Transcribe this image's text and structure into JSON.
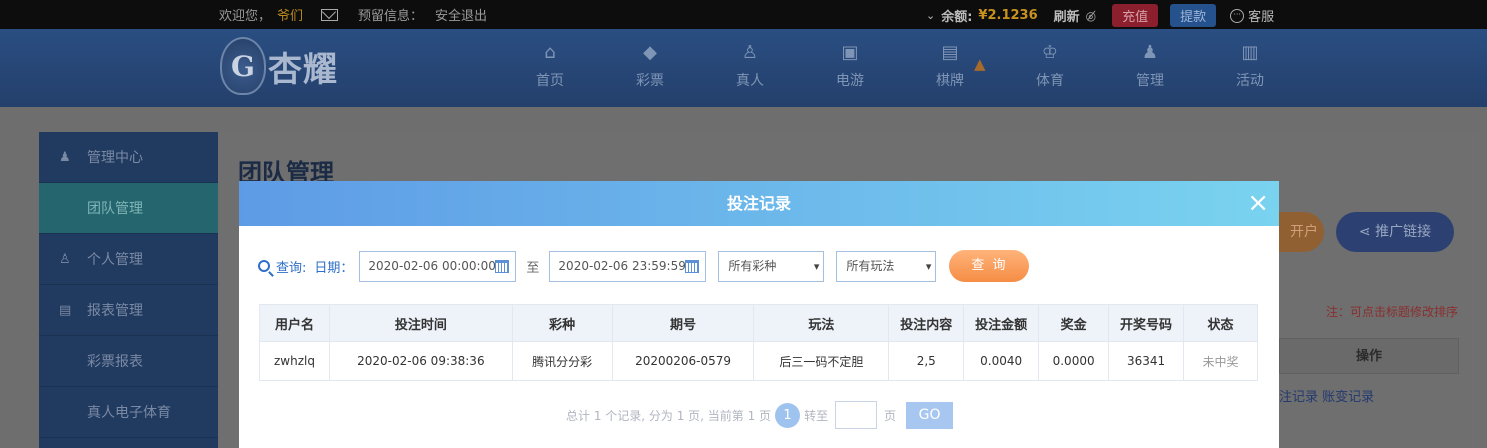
{
  "topbar": {
    "welcome": "欢迎您，",
    "username": "爷们",
    "reserved_info": "预留信息：",
    "logout": "安全退出",
    "balance_label": "余额:",
    "balance_value": "¥2.1236",
    "refresh": "刷新",
    "recharge": "充值",
    "withdraw": "提款",
    "customer_service": "客服"
  },
  "header": {
    "logo_text": "杏耀",
    "nav": [
      {
        "label": "首页",
        "icon": "home-icon"
      },
      {
        "label": "彩票",
        "icon": "ticket-icon"
      },
      {
        "label": "真人",
        "icon": "person-icon"
      },
      {
        "label": "电游",
        "icon": "slot-icon"
      },
      {
        "label": "棋牌",
        "icon": "cards-icon"
      },
      {
        "label": "体育",
        "icon": "trophy-icon"
      },
      {
        "label": "管理",
        "icon": "users-icon"
      },
      {
        "label": "活动",
        "icon": "gift-icon"
      }
    ]
  },
  "sidebar": {
    "items": [
      {
        "label": "管理中心"
      },
      {
        "label": "团队管理"
      },
      {
        "label": "个人管理"
      },
      {
        "label": "报表管理"
      },
      {
        "label": "彩票报表"
      },
      {
        "label": "真人电子体育"
      }
    ]
  },
  "content": {
    "title": "团队管理",
    "open_account_partial": "开户",
    "promo_link": "推广链接",
    "note": "注：可点击标题修改排序",
    "op_header": "操作",
    "op_links": "注记录 账变记录"
  },
  "modal": {
    "title": "投注记录",
    "close": "×",
    "query_label": "查询:",
    "date_label": "日期：",
    "start_date": "2020-02-06 00:00:00",
    "to": "至",
    "end_date": "2020-02-06 23:59:59",
    "lottery_select": "所有彩种",
    "play_select": "所有玩法",
    "query_button": "查 询",
    "columns": [
      "用户名",
      "投注时间",
      "彩种",
      "期号",
      "玩法",
      "投注内容",
      "投注金额",
      "奖金",
      "开奖号码",
      "状态"
    ],
    "rows": [
      [
        "zwhzlq",
        "2020-02-06 09:38:36",
        "腾讯分分彩",
        "20200206-0579",
        "后三一码不定胆",
        "2,5",
        "0.0040",
        "0.0000",
        "36341",
        "未中奖"
      ]
    ],
    "pager": {
      "summary": "总计 1 个记录, 分为 1 页, 当前第 1 页",
      "current": "1",
      "goto": "转至",
      "page_unit": "页",
      "go": "GO"
    }
  }
}
